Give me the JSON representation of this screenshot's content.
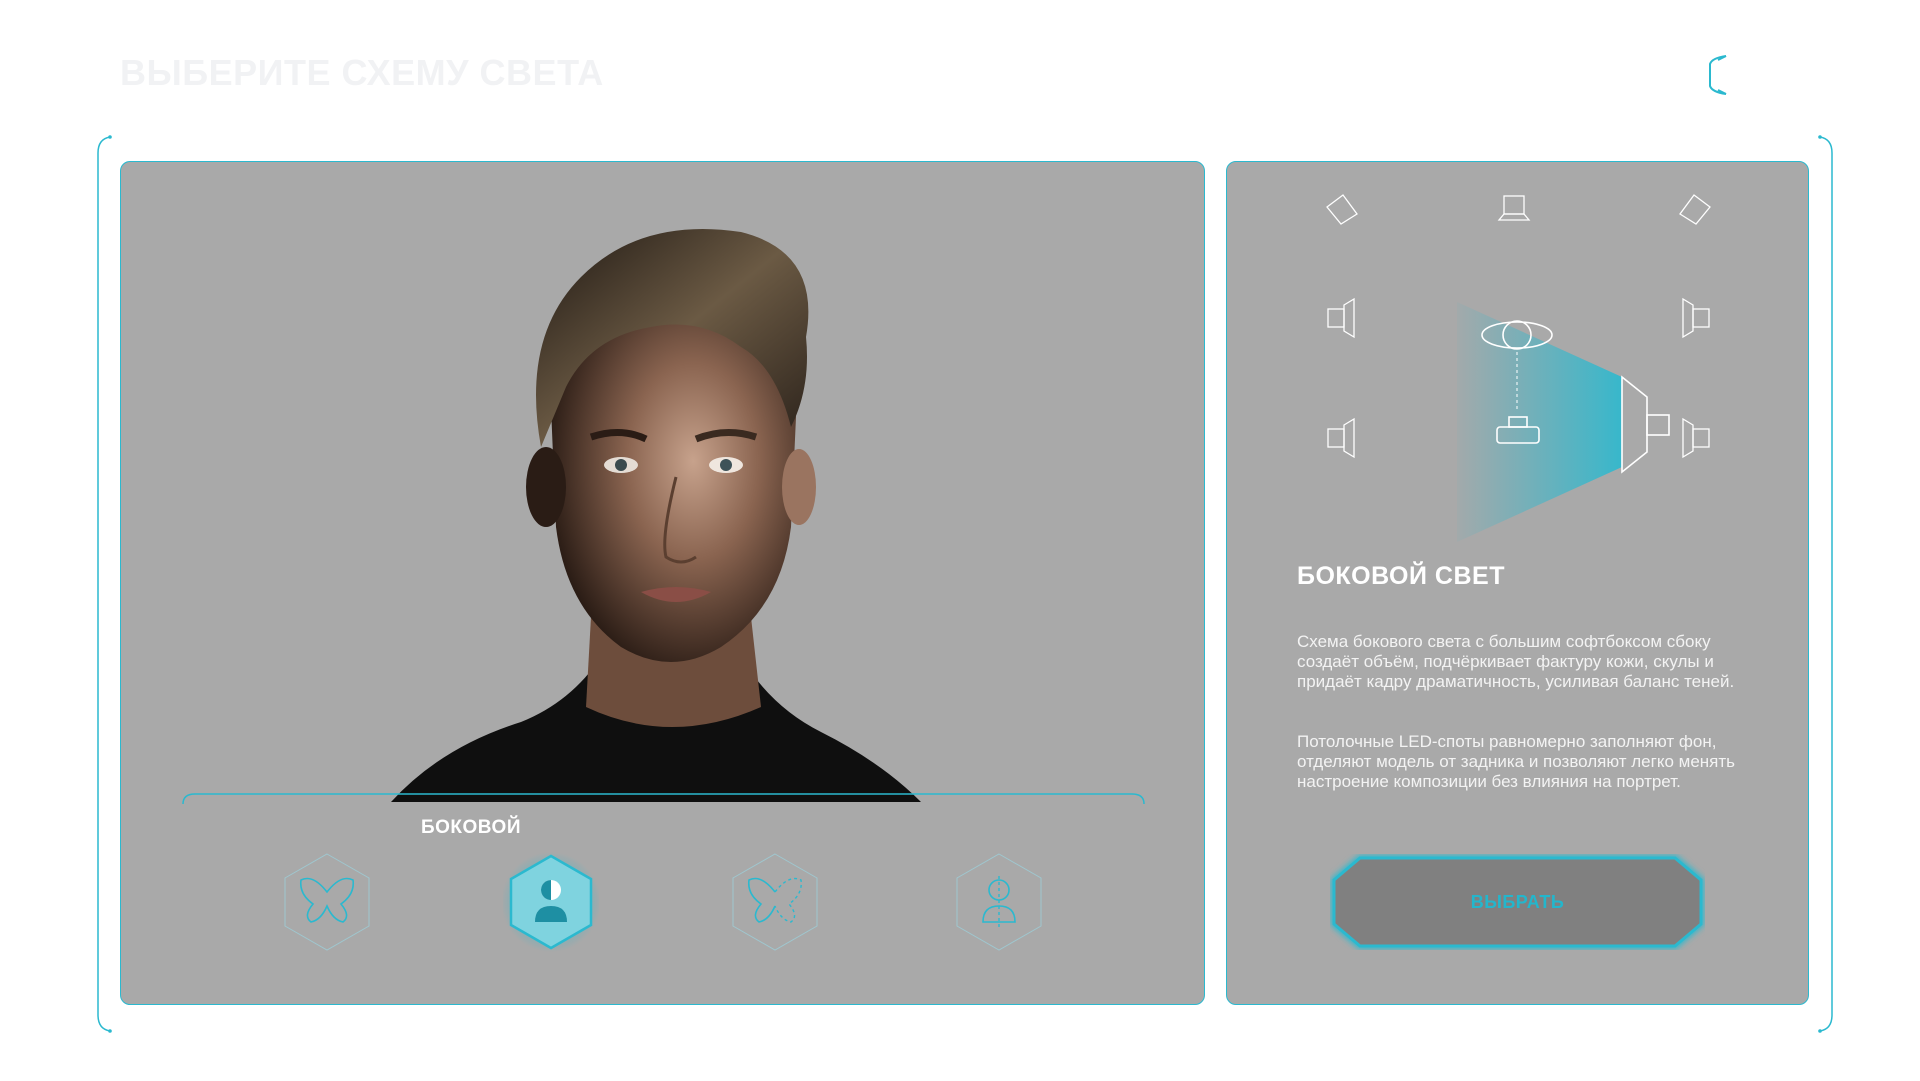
{
  "header": {
    "title": "ВЫБЕРИТЕ СХЕМУ СВЕТА",
    "back_icon": "chevron-left-icon"
  },
  "colors": {
    "accent": "#2bb9cf",
    "panel_bg": "#a9a9a9",
    "button_bg": "#808080",
    "title_faint": "#f1f2f4"
  },
  "portrait": {
    "icon": "portrait-photo"
  },
  "schemes": {
    "selected_label": "БОКОВОЙ",
    "items": [
      {
        "icon": "butterfly-icon",
        "selected": false
      },
      {
        "icon": "side-light-icon",
        "selected": true
      },
      {
        "icon": "split-butterfly-icon",
        "selected": false
      },
      {
        "icon": "rembrandt-icon",
        "selected": false
      }
    ]
  },
  "info": {
    "title": "БОКОВОЙ СВЕТ",
    "paragraph1": "Схема бокового света с большим софтбоксом сбоку создаёт объём, подчёркивает фактуру кожи, скулы и придаёт кадру драматичность, усиливая баланс теней.",
    "paragraph2": "Потолочные LED-споты равномерно заполняют фон, отделяют модель от задника и позволяют легко менять настроение композиции без влияния на портрет.",
    "select_button": "ВЫБРАТЬ"
  }
}
